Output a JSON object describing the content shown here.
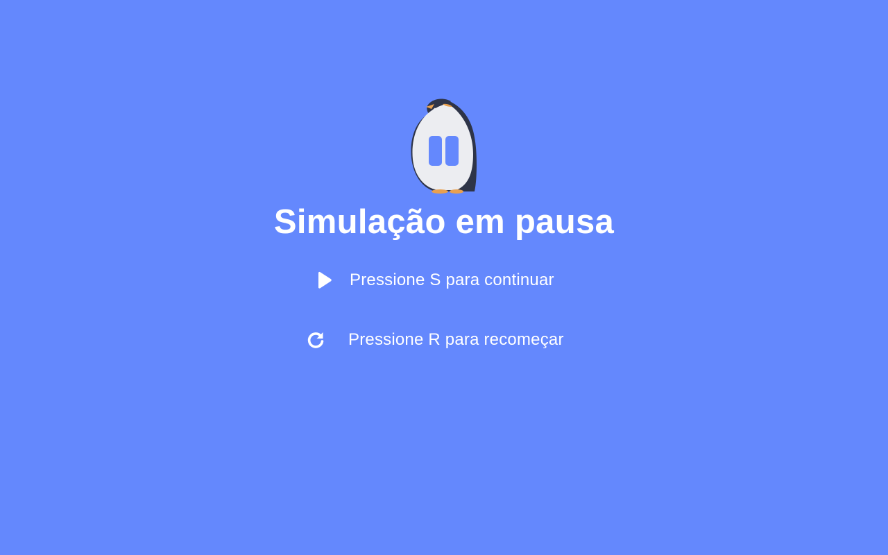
{
  "colors": {
    "background": "#6488fd",
    "text": "#ffffff",
    "penguin_body": "#ecedf1",
    "penguin_back": "#2e3448",
    "penguin_beak": "#e8a050"
  },
  "pause_screen": {
    "icon": "penguin-pause-icon",
    "title": "Simulação em pausa",
    "hints": [
      {
        "icon": "play-icon",
        "text": "Pressione S para continuar"
      },
      {
        "icon": "restart-icon",
        "text": "Pressione R para recomeçar"
      }
    ]
  }
}
